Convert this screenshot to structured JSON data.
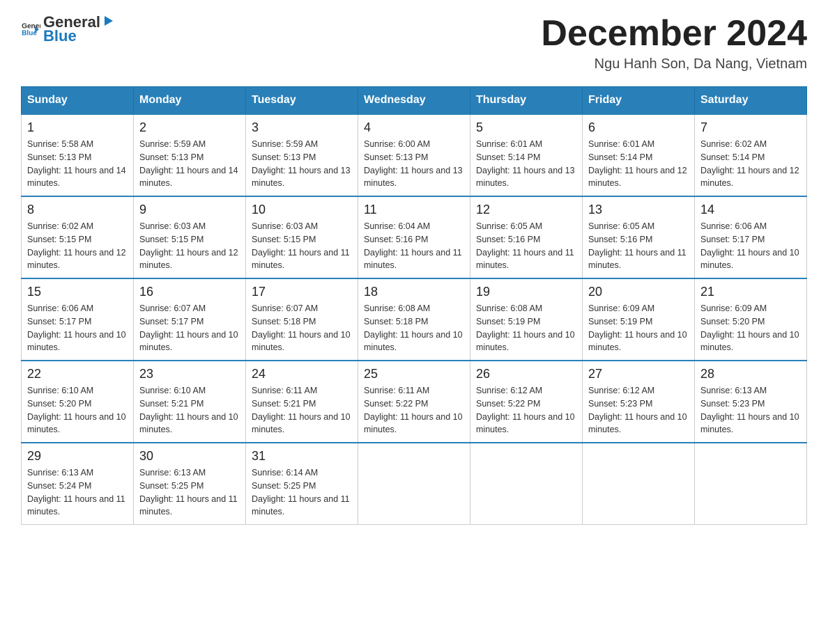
{
  "header": {
    "logo": {
      "general": "General",
      "arrow_icon": "▶",
      "blue": "Blue"
    },
    "title": "December 2024",
    "location": "Ngu Hanh Son, Da Nang, Vietnam"
  },
  "days_of_week": [
    "Sunday",
    "Monday",
    "Tuesday",
    "Wednesday",
    "Thursday",
    "Friday",
    "Saturday"
  ],
  "weeks": [
    [
      {
        "day": "1",
        "sunrise": "5:58 AM",
        "sunset": "5:13 PM",
        "daylight": "11 hours and 14 minutes."
      },
      {
        "day": "2",
        "sunrise": "5:59 AM",
        "sunset": "5:13 PM",
        "daylight": "11 hours and 14 minutes."
      },
      {
        "day": "3",
        "sunrise": "5:59 AM",
        "sunset": "5:13 PM",
        "daylight": "11 hours and 13 minutes."
      },
      {
        "day": "4",
        "sunrise": "6:00 AM",
        "sunset": "5:13 PM",
        "daylight": "11 hours and 13 minutes."
      },
      {
        "day": "5",
        "sunrise": "6:01 AM",
        "sunset": "5:14 PM",
        "daylight": "11 hours and 13 minutes."
      },
      {
        "day": "6",
        "sunrise": "6:01 AM",
        "sunset": "5:14 PM",
        "daylight": "11 hours and 12 minutes."
      },
      {
        "day": "7",
        "sunrise": "6:02 AM",
        "sunset": "5:14 PM",
        "daylight": "11 hours and 12 minutes."
      }
    ],
    [
      {
        "day": "8",
        "sunrise": "6:02 AM",
        "sunset": "5:15 PM",
        "daylight": "11 hours and 12 minutes."
      },
      {
        "day": "9",
        "sunrise": "6:03 AM",
        "sunset": "5:15 PM",
        "daylight": "11 hours and 12 minutes."
      },
      {
        "day": "10",
        "sunrise": "6:03 AM",
        "sunset": "5:15 PM",
        "daylight": "11 hours and 11 minutes."
      },
      {
        "day": "11",
        "sunrise": "6:04 AM",
        "sunset": "5:16 PM",
        "daylight": "11 hours and 11 minutes."
      },
      {
        "day": "12",
        "sunrise": "6:05 AM",
        "sunset": "5:16 PM",
        "daylight": "11 hours and 11 minutes."
      },
      {
        "day": "13",
        "sunrise": "6:05 AM",
        "sunset": "5:16 PM",
        "daylight": "11 hours and 11 minutes."
      },
      {
        "day": "14",
        "sunrise": "6:06 AM",
        "sunset": "5:17 PM",
        "daylight": "11 hours and 10 minutes."
      }
    ],
    [
      {
        "day": "15",
        "sunrise": "6:06 AM",
        "sunset": "5:17 PM",
        "daylight": "11 hours and 10 minutes."
      },
      {
        "day": "16",
        "sunrise": "6:07 AM",
        "sunset": "5:17 PM",
        "daylight": "11 hours and 10 minutes."
      },
      {
        "day": "17",
        "sunrise": "6:07 AM",
        "sunset": "5:18 PM",
        "daylight": "11 hours and 10 minutes."
      },
      {
        "day": "18",
        "sunrise": "6:08 AM",
        "sunset": "5:18 PM",
        "daylight": "11 hours and 10 minutes."
      },
      {
        "day": "19",
        "sunrise": "6:08 AM",
        "sunset": "5:19 PM",
        "daylight": "11 hours and 10 minutes."
      },
      {
        "day": "20",
        "sunrise": "6:09 AM",
        "sunset": "5:19 PM",
        "daylight": "11 hours and 10 minutes."
      },
      {
        "day": "21",
        "sunrise": "6:09 AM",
        "sunset": "5:20 PM",
        "daylight": "11 hours and 10 minutes."
      }
    ],
    [
      {
        "day": "22",
        "sunrise": "6:10 AM",
        "sunset": "5:20 PM",
        "daylight": "11 hours and 10 minutes."
      },
      {
        "day": "23",
        "sunrise": "6:10 AM",
        "sunset": "5:21 PM",
        "daylight": "11 hours and 10 minutes."
      },
      {
        "day": "24",
        "sunrise": "6:11 AM",
        "sunset": "5:21 PM",
        "daylight": "11 hours and 10 minutes."
      },
      {
        "day": "25",
        "sunrise": "6:11 AM",
        "sunset": "5:22 PM",
        "daylight": "11 hours and 10 minutes."
      },
      {
        "day": "26",
        "sunrise": "6:12 AM",
        "sunset": "5:22 PM",
        "daylight": "11 hours and 10 minutes."
      },
      {
        "day": "27",
        "sunrise": "6:12 AM",
        "sunset": "5:23 PM",
        "daylight": "11 hours and 10 minutes."
      },
      {
        "day": "28",
        "sunrise": "6:13 AM",
        "sunset": "5:23 PM",
        "daylight": "11 hours and 10 minutes."
      }
    ],
    [
      {
        "day": "29",
        "sunrise": "6:13 AM",
        "sunset": "5:24 PM",
        "daylight": "11 hours and 11 minutes."
      },
      {
        "day": "30",
        "sunrise": "6:13 AM",
        "sunset": "5:25 PM",
        "daylight": "11 hours and 11 minutes."
      },
      {
        "day": "31",
        "sunrise": "6:14 AM",
        "sunset": "5:25 PM",
        "daylight": "11 hours and 11 minutes."
      },
      null,
      null,
      null,
      null
    ]
  ],
  "colors": {
    "header_bg": "#2980b9",
    "border_accent": "#2980b9"
  }
}
